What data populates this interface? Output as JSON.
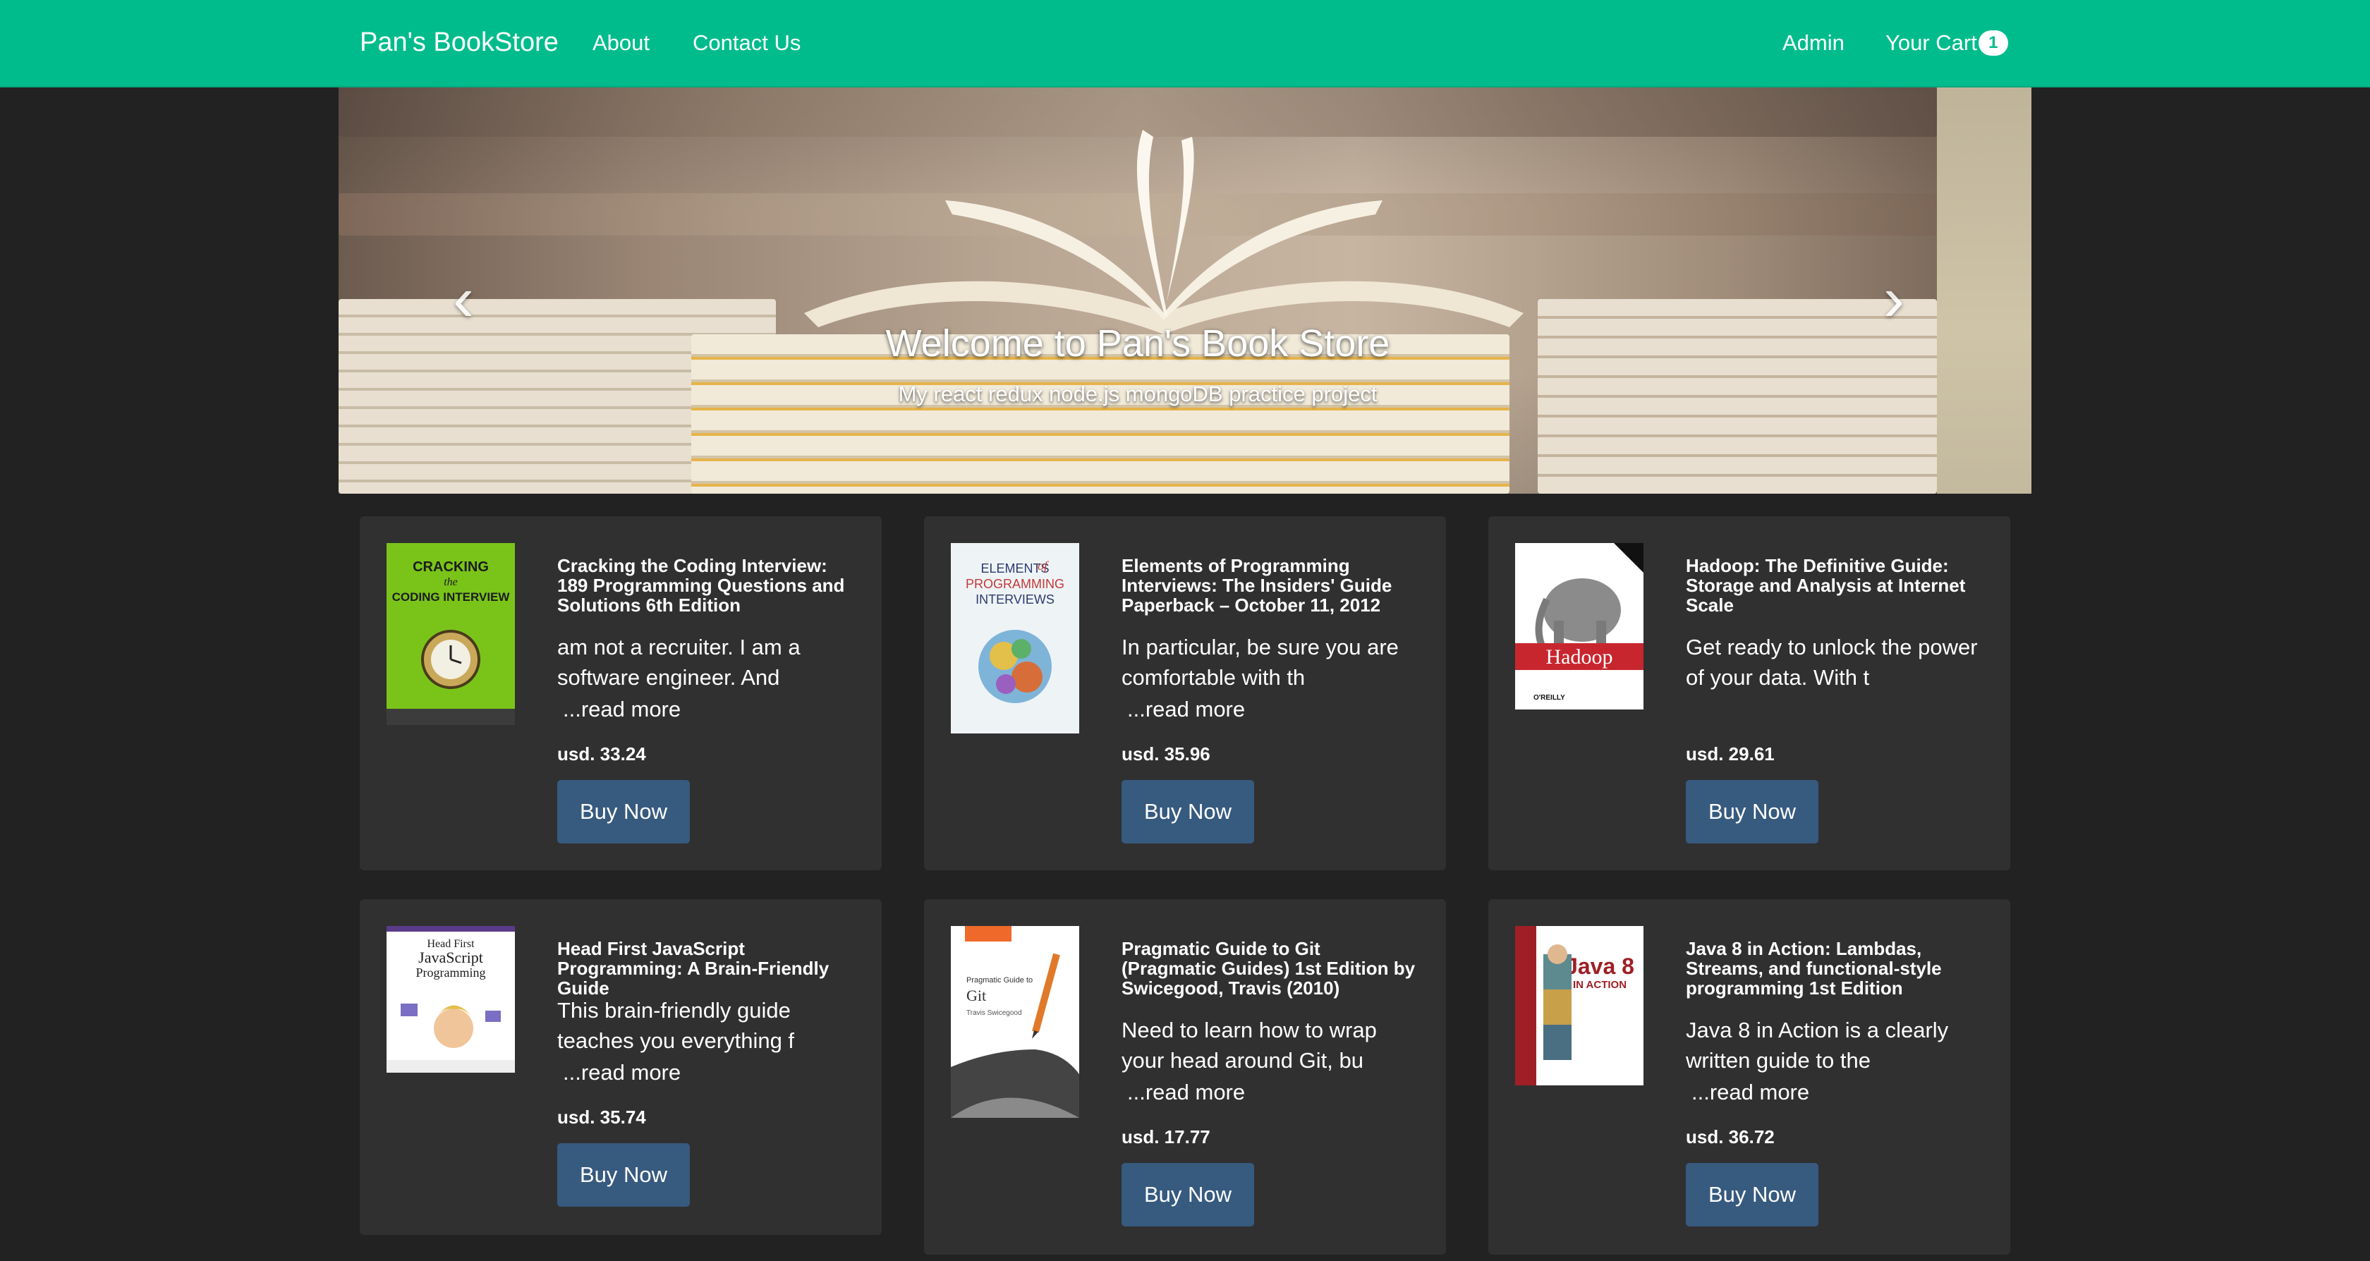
{
  "navbar": {
    "brand": "Pan's BookStore",
    "links": [
      "About",
      "Contact Us"
    ],
    "admin": "Admin",
    "cart_label": "Your Cart",
    "cart_count": "1",
    "color": "#00bc8c"
  },
  "carousel": {
    "title": "Welcome to Pan's Book Store",
    "subtitle": "My react redux node.js mongoDB practice project",
    "prev_icon": "chevron-left-icon",
    "next_icon": "chevron-right-icon",
    "slide_count": 2,
    "active_slide": 1
  },
  "books": [
    {
      "title": "Cracking the Coding Interview: 189 Programming Questions and Solutions 6th Edition",
      "desc": "am not a recruiter. I am a software engineer. And",
      "read_more": "...read more",
      "price": "usd. 33.24",
      "buy": "Buy Now",
      "cover": {
        "line1": "CRACKING",
        "line2": "the",
        "line3": "CODING INTERVIEW",
        "bg": "#7ac41a"
      }
    },
    {
      "title": "Elements of Programming Interviews: The Insiders' Guide Paperback – October 11, 2012",
      "desc": "In particular, be sure you are comfortable with th",
      "read_more": "...read more",
      "price": "usd. 35.96",
      "buy": "Buy Now",
      "cover": {
        "line1": "ELEMENTS",
        "line2": "of",
        "line3": "PROGRAMMING",
        "line4": "INTERVIEWS",
        "bg": "#eef3f6"
      }
    },
    {
      "title": "Hadoop: The Definitive Guide: Storage and Analysis at Internet Scale",
      "desc": "Get ready to unlock the power of your data. With t",
      "read_more": "...read more",
      "price": "usd. 29.61",
      "buy": "Buy Now",
      "cover": {
        "line1": "Hadoop",
        "line2": "O'REILLY",
        "bg": "#ffffff"
      }
    },
    {
      "title": "Head First JavaScript Programming: A Brain-Friendly Guide",
      "desc": "This brain-friendly guide teaches you everything f",
      "read_more": "...read more",
      "price": "usd. 35.74",
      "buy": "Buy Now",
      "cover": {
        "line1": "Head First",
        "line2": "JavaScript",
        "line3": "Programming",
        "bg": "#ffffff"
      }
    },
    {
      "title": "Pragmatic Guide to Git (Pragmatic Guides) 1st Edition by Swicegood, Travis (2010)",
      "desc": "Need to learn how to wrap your head around Git, bu",
      "read_more": "...read more",
      "price": "usd. 17.77",
      "buy": "Buy Now",
      "cover": {
        "line1": "Pragmatic Guide to",
        "line2": "Git",
        "line3": "Travis Swicegood",
        "bg": "#ffffff"
      }
    },
    {
      "title": "Java 8 in Action: Lambdas, Streams, and functional-style programming 1st Edition",
      "desc": "Java 8 in Action is a clearly written guide to the",
      "read_more": "...read more",
      "price": "usd. 36.72",
      "buy": "Buy Now",
      "cover": {
        "line1": "Java 8",
        "line2": "IN ACTION",
        "bg": "#ffffff"
      }
    }
  ]
}
